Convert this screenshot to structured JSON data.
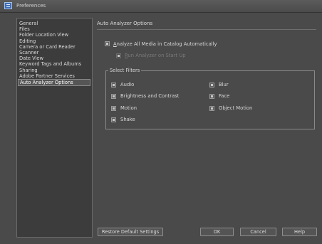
{
  "window": {
    "title": "Preferences"
  },
  "sidebar": {
    "items": [
      {
        "label": "General"
      },
      {
        "label": "Files"
      },
      {
        "label": "Folder Location View"
      },
      {
        "label": "Editing"
      },
      {
        "label": "Camera or Card Reader"
      },
      {
        "label": "Scanner"
      },
      {
        "label": "Date View"
      },
      {
        "label": "Keyword Tags and Albums"
      },
      {
        "label": "Sharing"
      },
      {
        "label": "Adobe Partner Services"
      },
      {
        "label": "Auto Analyzer Options",
        "selected": true
      }
    ]
  },
  "main": {
    "section_title": "Auto Analyzer Options",
    "analyze_all": {
      "label_accel": "A",
      "label_rest": "nalyze All Media in Catalog Automatically",
      "checked": true
    },
    "run_on_startup": {
      "label_accel": "R",
      "label_rest": "un Analyzer on Start Up",
      "checked": true,
      "disabled": true
    },
    "filters": {
      "legend": "Select Filters",
      "items": [
        {
          "label": "Audio",
          "checked": true
        },
        {
          "label": "Blur",
          "checked": true
        },
        {
          "label": "Brightness and Contrast",
          "checked": true
        },
        {
          "label": "Face",
          "checked": true
        },
        {
          "label": "Motion",
          "checked": true
        },
        {
          "label": "Object Motion",
          "checked": true
        },
        {
          "label": "Shake",
          "checked": true
        }
      ]
    }
  },
  "buttons": {
    "restore": "Restore Default Settings",
    "ok": "OK",
    "cancel": "Cancel",
    "help": "Help"
  }
}
